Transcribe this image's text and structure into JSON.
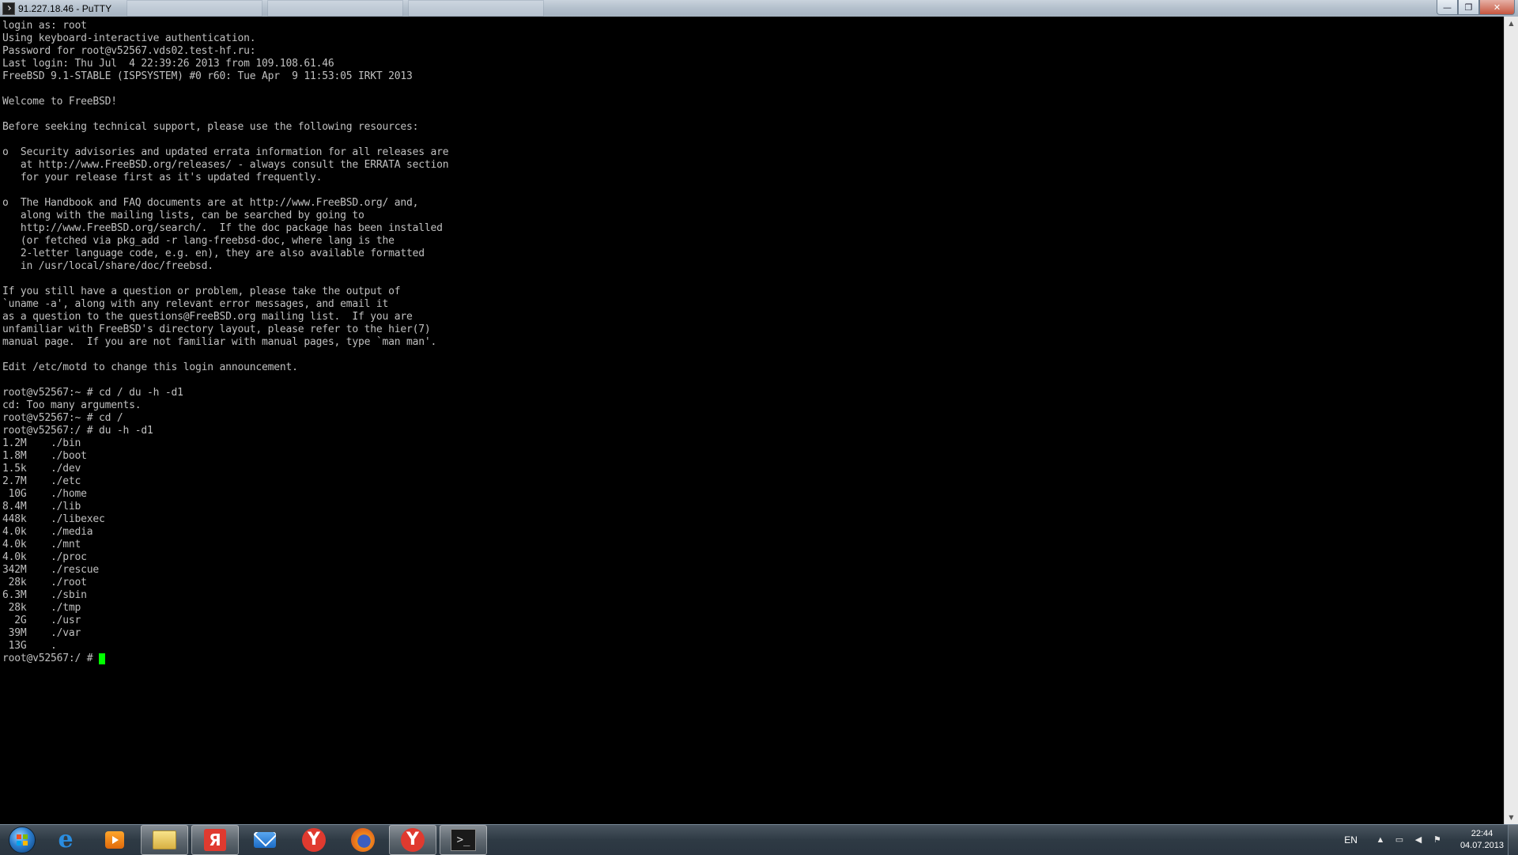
{
  "window": {
    "title": "91.227.18.46 - PuTTY",
    "minimize_label": "—",
    "maximize_label": "❐",
    "close_label": "✕"
  },
  "terminal": {
    "lines": [
      "login as: root",
      "Using keyboard-interactive authentication.",
      "Password for root@v52567.vds02.test-hf.ru:",
      "Last login: Thu Jul  4 22:39:26 2013 from 109.108.61.46",
      "FreeBSD 9.1-STABLE (ISPSYSTEM) #0 r60: Tue Apr  9 11:53:05 IRKT 2013",
      "",
      "Welcome to FreeBSD!",
      "",
      "Before seeking technical support, please use the following resources:",
      "",
      "o  Security advisories and updated errata information for all releases are",
      "   at http://www.FreeBSD.org/releases/ - always consult the ERRATA section",
      "   for your release first as it's updated frequently.",
      "",
      "o  The Handbook and FAQ documents are at http://www.FreeBSD.org/ and,",
      "   along with the mailing lists, can be searched by going to",
      "   http://www.FreeBSD.org/search/.  If the doc package has been installed",
      "   (or fetched via pkg_add -r lang-freebsd-doc, where lang is the",
      "   2-letter language code, e.g. en), they are also available formatted",
      "   in /usr/local/share/doc/freebsd.",
      "",
      "If you still have a question or problem, please take the output of",
      "`uname -a', along with any relevant error messages, and email it",
      "as a question to the questions@FreeBSD.org mailing list.  If you are",
      "unfamiliar with FreeBSD's directory layout, please refer to the hier(7)",
      "manual page.  If you are not familiar with manual pages, type `man man'.",
      "",
      "Edit /etc/motd to change this login announcement.",
      "",
      "root@v52567:~ # cd / du -h -d1",
      "cd: Too many arguments.",
      "root@v52567:~ # cd /",
      "root@v52567:/ # du -h -d1",
      "1.2M    ./bin",
      "1.8M    ./boot",
      "1.5k    ./dev",
      "2.7M    ./etc",
      " 10G    ./home",
      "8.4M    ./lib",
      "448k    ./libexec",
      "4.0k    ./media",
      "4.0k    ./mnt",
      "4.0k    ./proc",
      "342M    ./rescue",
      " 28k    ./root",
      "6.3M    ./sbin",
      " 28k    ./tmp",
      "  2G    ./usr",
      " 39M    ./var",
      " 13G    ."
    ],
    "prompt": "root@v52567:/ # ",
    "cursor_color": "#00ff00"
  },
  "scrollbar": {
    "up_label": "▲",
    "down_label": "▼"
  },
  "taskbar": {
    "items": [
      {
        "icon": "internet-explorer-icon",
        "glyph": "e"
      },
      {
        "icon": "media-player-icon",
        "glyph": ""
      },
      {
        "icon": "explorer-folder-icon",
        "glyph": ""
      },
      {
        "icon": "yandex-icon",
        "glyph": "Я"
      },
      {
        "icon": "mail-icon",
        "glyph": ""
      },
      {
        "icon": "yandex-browser-icon",
        "glyph": "Y"
      },
      {
        "icon": "firefox-icon",
        "glyph": ""
      },
      {
        "icon": "yandex-browser-icon",
        "glyph": "Y"
      },
      {
        "icon": "putty-icon",
        "glyph": ">_"
      }
    ],
    "tray": {
      "language": "EN",
      "time": "22:44",
      "date": "04.07.2013"
    }
  }
}
